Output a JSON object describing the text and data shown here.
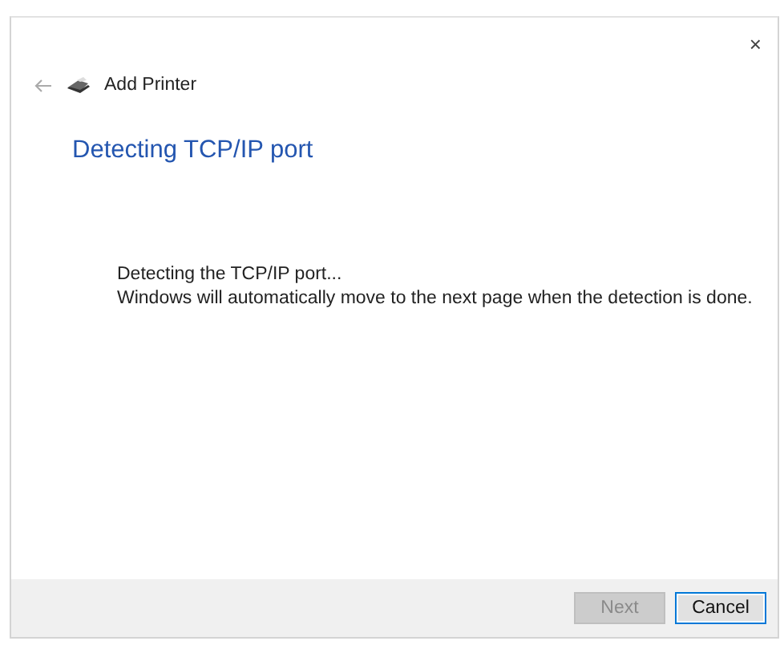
{
  "window": {
    "title": "Add Printer",
    "close": "×"
  },
  "heading": "Detecting TCP/IP port",
  "body": [
    "Detecting the TCP/IP port...",
    "Windows will automatically move to the next page when the detection is done."
  ],
  "buttons": [
    {
      "label": "Next",
      "disabled": true,
      "default": false
    },
    {
      "label": "Cancel",
      "disabled": false,
      "default": true
    }
  ]
}
